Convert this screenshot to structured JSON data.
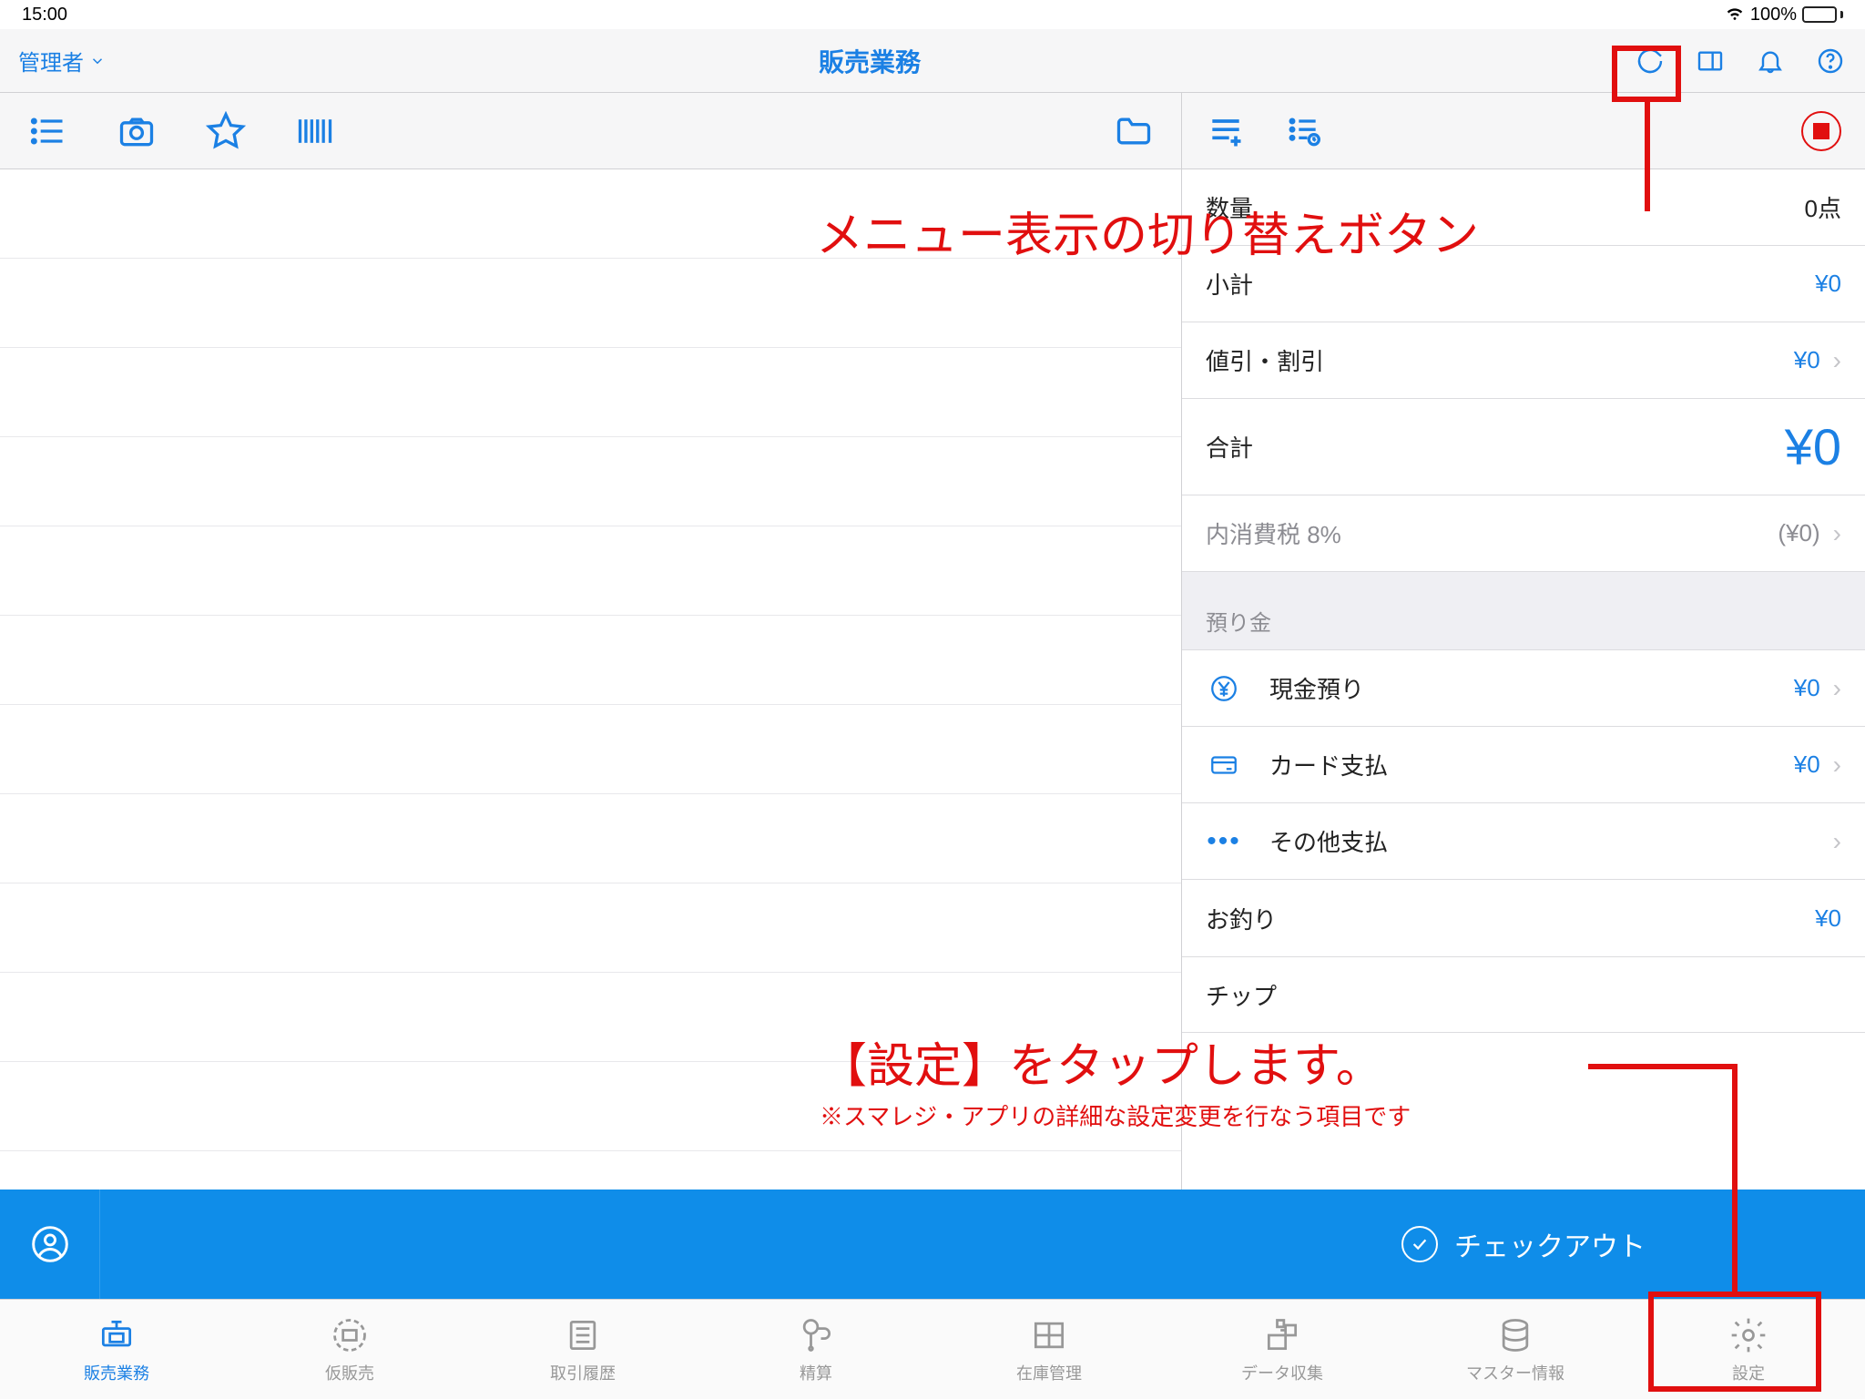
{
  "status": {
    "time": "15:00",
    "battery_pct": "100%"
  },
  "nav": {
    "user_label": "管理者",
    "title": "販売業務"
  },
  "summary": {
    "qty_label": "数量",
    "qty_value": "0点",
    "subtotal_label": "小計",
    "subtotal_value": "¥0",
    "discount_label": "値引・割引",
    "discount_value": "¥0",
    "total_label": "合計",
    "total_value": "¥0",
    "tax_label": "内消費税 8%",
    "tax_value": "(¥0)",
    "deposit_section": "預り金",
    "cash_label": "現金預り",
    "cash_value": "¥0",
    "card_label": "カード支払",
    "card_value": "¥0",
    "other_label": "その他支払",
    "change_label": "お釣り",
    "change_value": "¥0",
    "tip_label": "チップ"
  },
  "checkout": {
    "label": "チェックアウト"
  },
  "tabs": [
    {
      "label": "販売業務"
    },
    {
      "label": "仮販売"
    },
    {
      "label": "取引履歴"
    },
    {
      "label": "精算"
    },
    {
      "label": "在庫管理"
    },
    {
      "label": "データ収集"
    },
    {
      "label": "マスター情報"
    },
    {
      "label": "設定"
    }
  ],
  "annotations": {
    "menu_toggle": "メニュー表示の切り替えボタン",
    "settings_tap": "【設定】をタップします。",
    "settings_sub": "※スマレジ・アプリの詳細な設定変更を行なう項目です"
  }
}
